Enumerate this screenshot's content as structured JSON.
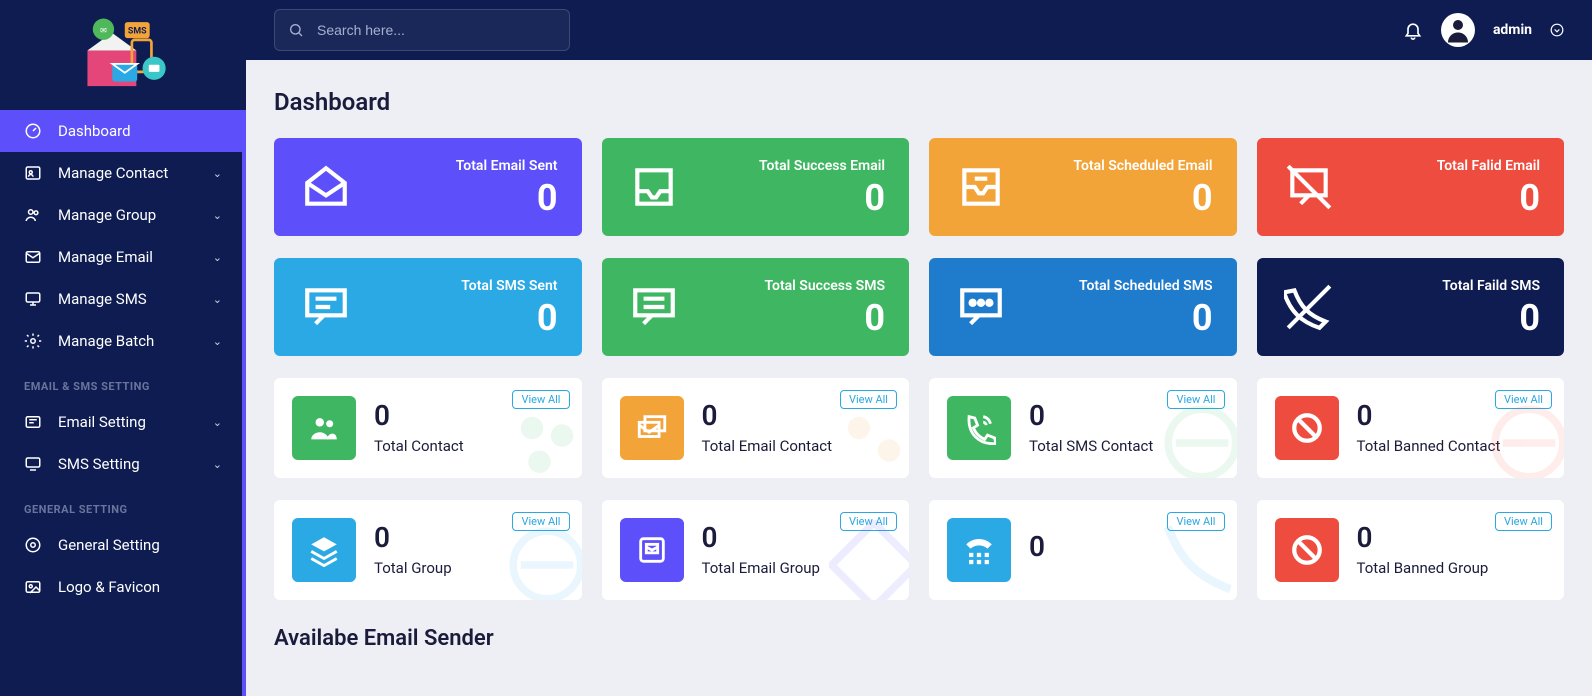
{
  "search": {
    "placeholder": "Search here..."
  },
  "user": {
    "name": "admin"
  },
  "page": {
    "title": "Dashboard",
    "section_available_sender": "Availabe Email Sender"
  },
  "sidebar": {
    "items": [
      {
        "label": "Dashboard"
      },
      {
        "label": "Manage Contact"
      },
      {
        "label": "Manage Group"
      },
      {
        "label": "Manage Email"
      },
      {
        "label": "Manage SMS"
      },
      {
        "label": "Manage Batch"
      }
    ],
    "section_email_sms": "EMAIL & SMS SETTING",
    "email_sms_items": [
      {
        "label": "Email Setting"
      },
      {
        "label": "SMS Setting"
      }
    ],
    "section_general": "GENERAL SETTING",
    "general_items": [
      {
        "label": "General Setting"
      },
      {
        "label": "Logo & Favicon"
      }
    ]
  },
  "tiles": {
    "row1": [
      {
        "label": "Total Email Sent",
        "value": "0",
        "color": "#5d4ff9"
      },
      {
        "label": "Total Success Email",
        "value": "0",
        "color": "#3fb762"
      },
      {
        "label": "Total Scheduled Email",
        "value": "0",
        "color": "#f3a439"
      },
      {
        "label": "Total Falid Email",
        "value": "0",
        "color": "#ee4c3f"
      }
    ],
    "row2": [
      {
        "label": "Total SMS Sent",
        "value": "0",
        "color": "#2ba9e4"
      },
      {
        "label": "Total Success SMS",
        "value": "0",
        "color": "#3fb762"
      },
      {
        "label": "Total Scheduled SMS",
        "value": "0",
        "color": "#1f7bcb"
      },
      {
        "label": "Total Faild SMS",
        "value": "0",
        "color": "#0e1c51"
      }
    ]
  },
  "view_all_label": "View All",
  "cards": {
    "row3": [
      {
        "value": "0",
        "label": "Total Contact",
        "color": "#3fb762"
      },
      {
        "value": "0",
        "label": "Total Email Contact",
        "color": "#f3a439"
      },
      {
        "value": "0",
        "label": "Total SMS Contact",
        "color": "#3fb762"
      },
      {
        "value": "0",
        "label": "Total Banned Contact",
        "color": "#ee4c3f"
      }
    ],
    "row4": [
      {
        "value": "0",
        "label": "Total Group",
        "color": "#2ba9e4"
      },
      {
        "value": "0",
        "label": "Total Email Group",
        "color": "#5d4ff9"
      },
      {
        "value": "0",
        "label": "",
        "color": "#2ba9e4"
      },
      {
        "value": "0",
        "label": "Total Banned Group",
        "color": "#ee4c3f"
      }
    ]
  }
}
